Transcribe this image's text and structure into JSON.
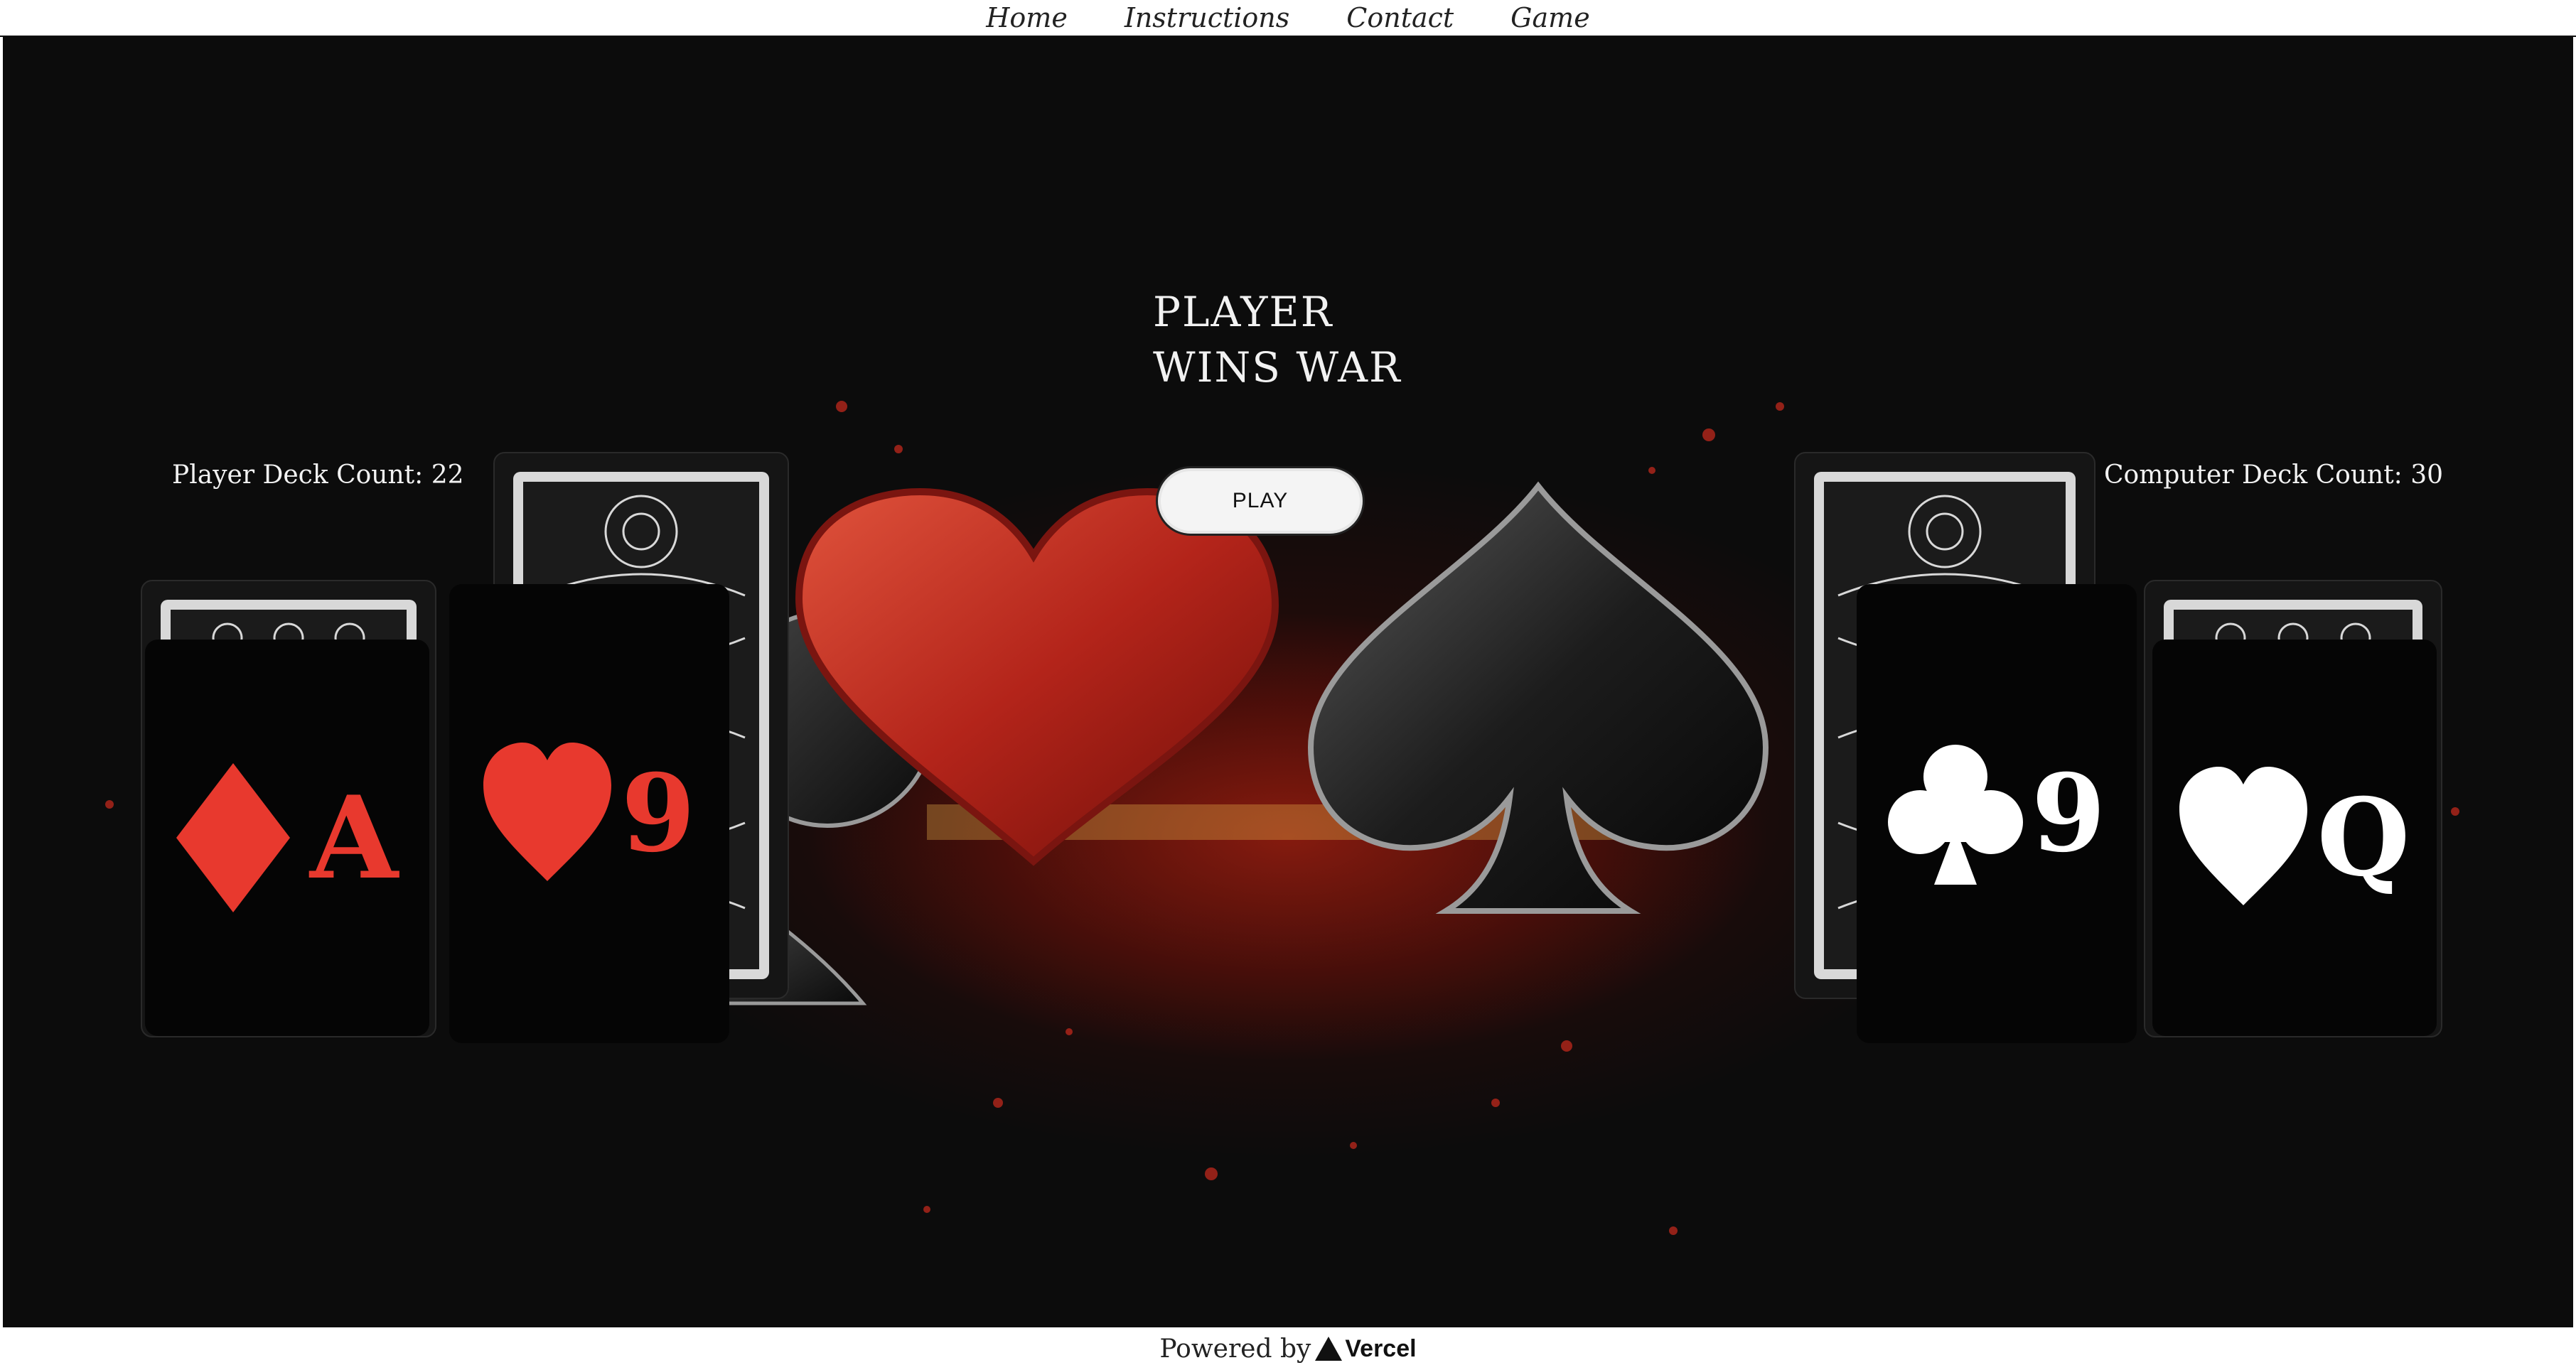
{
  "nav": {
    "items": [
      {
        "label": "Home"
      },
      {
        "label": "Instructions"
      },
      {
        "label": "Contact"
      },
      {
        "label": "Game"
      }
    ]
  },
  "game": {
    "result_title": "PLAYER WINS WAR",
    "player_deck_count": "Player Deck Count: 22",
    "computer_deck_count": "Computer Deck Count: 30",
    "play_label": "PLAY",
    "player_cards": [
      {
        "rank": "A",
        "suit": "diamond",
        "color": "#e8392e"
      },
      {
        "rank": "9",
        "suit": "heart",
        "color": "#e8392e"
      }
    ],
    "computer_cards": [
      {
        "rank": "9",
        "suit": "club",
        "color": "#ffffff"
      },
      {
        "rank": "Q",
        "suit": "heart",
        "color": "#ffffff"
      }
    ]
  },
  "footer": {
    "powered_by": "Powered by",
    "brand": "Vercel"
  }
}
